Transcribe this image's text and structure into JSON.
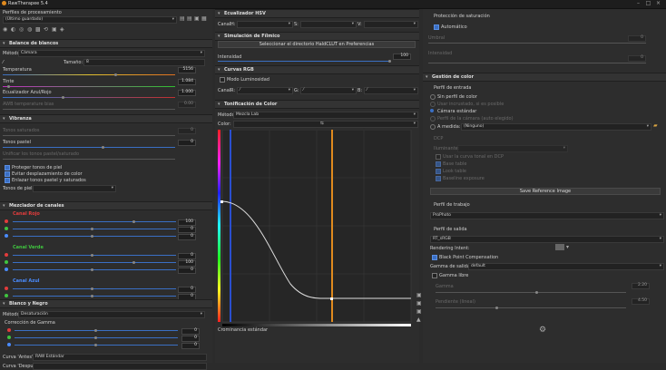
{
  "window": {
    "title": "RawTherapee 5.4"
  },
  "left": {
    "profiles_label": "Perfiles de procesamiento",
    "profile_value": "(Último guardado)",
    "wb": {
      "title": "Balance de blancos",
      "method_label": "Método:",
      "method_value": "Cámara",
      "size_label": "Tamaño:",
      "size_value": "8",
      "rows": [
        {
          "label": "Temperatura",
          "value": "5156"
        },
        {
          "label": "Tinte",
          "value": "1.084"
        },
        {
          "label": "Ecualizador Azul/Rojo",
          "value": "1.000"
        },
        {
          "label": "AWB temperature bias",
          "value": "0.00"
        }
      ]
    },
    "vib": {
      "title": "Vibranza",
      "rows": [
        {
          "label": "Tonos saturados",
          "value": "0"
        },
        {
          "label": "Tonos pastel",
          "value": "0"
        }
      ],
      "link": "Unificar los tonos pastel/saturado",
      "checks": [
        "Proteger tonos de piel",
        "Evitar desplazamiento de color",
        "Enlazar tonos pastel y saturados"
      ],
      "skin_label": "Tonos de piel: HH"
    },
    "mixer": {
      "title": "Mezclador de canales",
      "channels": [
        {
          "name": "Canal Rojo",
          "color": "#e23c3c",
          "values": [
            "100",
            "0",
            "0"
          ]
        },
        {
          "name": "Canal Verde",
          "color": "#3fc43f",
          "values": [
            "0",
            "100",
            "0"
          ]
        },
        {
          "name": "Canal Azul",
          "color": "#4a8cff",
          "values": [
            "0",
            "0",
            "100"
          ]
        }
      ]
    },
    "bw": {
      "title": "Blanco y Negro",
      "method_label": "Método:",
      "method_value": "Desaturación",
      "gamma_label": "Corrección de Gamma",
      "values": [
        "0",
        "0",
        "0"
      ],
      "curve1_label": "Curva 'Antes':",
      "curve1_value": "RAW Estándar",
      "curve2_label": "Curva 'Después':"
    }
  },
  "middle": {
    "hsv": {
      "title": "Ecualizador HSV",
      "channel_label": "Canal:",
      "h": "H:",
      "s": "S:",
      "v": "V:"
    },
    "film": {
      "title": "Simulación de Fílmico",
      "btn": "Seleccionar el directorio HaldCLUT en Preferencias",
      "intensity_label": "Intensidad",
      "intensity_value": "100"
    },
    "rgb": {
      "title": "Curvas RGB",
      "mode": "Modo Luminosidad",
      "channel_label": "Canal:",
      "r": "R:",
      "g": "G:",
      "b": "B:"
    },
    "toning": {
      "title": "Tonificación de Color",
      "method_label": "Método:",
      "method_value": "Mezcla Lab",
      "color_label": "Color:",
      "footer": "Crominancia estándar"
    }
  },
  "right": {
    "satprot": {
      "title": "Protección de saturación",
      "auto": "Automático",
      "threshold_label": "Umbral",
      "threshold_value": "0",
      "opacity_label": "Intensidad",
      "opacity_value": "0"
    },
    "cm": {
      "title": "Gestión de color",
      "input_title": "Perfil de entrada",
      "options": [
        "Sin perfil de color",
        "Usar incrustado, si es posible",
        "Cámara estándar",
        "Perfil de la cámara (auto elegido)"
      ],
      "custom_label": "A medida:",
      "custom_value": "(Ninguno)",
      "dcp_title": "DCP",
      "illuminant_label": "Iluminante:",
      "dcp_checks": [
        "Usar la curva tonal en DCP",
        "Base table",
        "Look table",
        "Baseline exposure"
      ],
      "save_ref": "Save Reference Image",
      "working_title": "Perfil de trabajo",
      "working_value": "ProPhoto",
      "output_title": "Perfil de salida",
      "output_value": "RT_sRGB",
      "intent_label": "Rendering Intent:",
      "bpc": "Black Point Compensation",
      "gamma_label": "Gamma de salida:",
      "gamma_value": "default",
      "free_gamma": "Gamma libre",
      "gamma_row_label": "Gamma",
      "gamma_row_value": "2.20",
      "slope_label": "Pendiente (lineal)",
      "slope_value": "4.50"
    }
  },
  "colors": {
    "accent": "#3a6fc4",
    "bg": "#2b2b2b",
    "orange": "#e08a1e",
    "blue": "#2a4fd0"
  }
}
